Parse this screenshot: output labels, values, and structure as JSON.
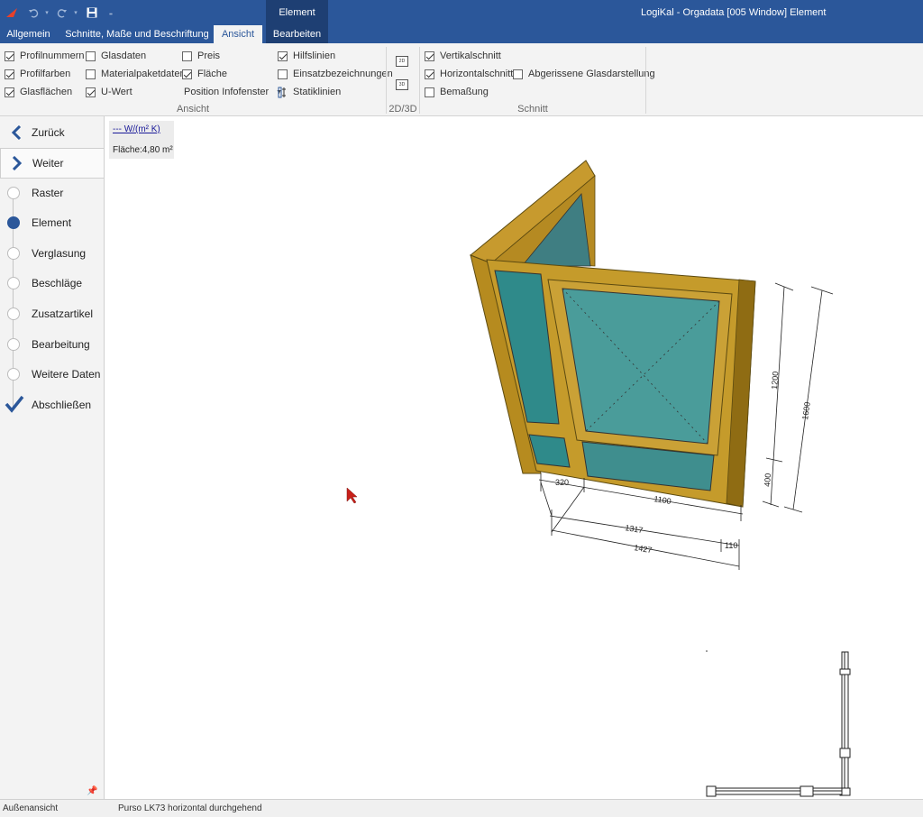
{
  "titlebar": {
    "app_title": "LogiKal - Orgadata [005 Window] Element",
    "context_group": "Element"
  },
  "tabs": [
    "Allgemein",
    "Schnitte, Maße und Beschriftung",
    "Ansicht",
    "Bearbeiten"
  ],
  "ribbon": {
    "ansicht": {
      "label": "Ansicht",
      "checks": [
        {
          "label": "Profilnummern",
          "checked": true
        },
        {
          "label": "Profilfarben",
          "checked": true
        },
        {
          "label": "Glasflächen",
          "checked": true
        },
        {
          "label": "Glasdaten",
          "checked": false
        },
        {
          "label": "Materialpaketdaten",
          "checked": false
        },
        {
          "label": "U-Wert",
          "checked": true
        },
        {
          "label": "Preis",
          "checked": false
        },
        {
          "label": "Fläche",
          "checked": true
        },
        {
          "label": "Hilfslinien",
          "checked": true
        },
        {
          "label": "Einsatzbezeichnungen",
          "checked": false
        }
      ],
      "position_infofenster": "Position Infofenster",
      "statiklinien": "Statiklinien"
    },
    "view_mode": {
      "label": "2D/3D",
      "btn_2d": "2D",
      "btn_3d": "3D"
    },
    "schnitt": {
      "label": "Schnitt",
      "checks": [
        {
          "label": "Vertikalschnitt",
          "checked": true
        },
        {
          "label": "Horizontalschnitt",
          "checked": true
        },
        {
          "label": "Bemaßung",
          "checked": false
        },
        {
          "label": "Abgerissene Glasdarstellung",
          "checked": false
        }
      ]
    }
  },
  "sidebar": {
    "back": "Zurück",
    "next": "Weiter",
    "steps": [
      {
        "label": "Raster",
        "state": "open"
      },
      {
        "label": "Element",
        "state": "current"
      },
      {
        "label": "Verglasung",
        "state": "open"
      },
      {
        "label": "Beschläge",
        "state": "open"
      },
      {
        "label": "Zusatzartikel",
        "state": "open"
      },
      {
        "label": "Bearbeitung",
        "state": "open"
      },
      {
        "label": "Weitere Daten",
        "state": "open"
      },
      {
        "label": "Abschließen",
        "state": "done"
      }
    ]
  },
  "canvas": {
    "info_uvalue": "--- W/(m² K)",
    "info_area": "Fläche:4,80 m²",
    "dimensions": {
      "height_upper": "1200",
      "height_lower": "400",
      "height_total": "1600",
      "width_side": "320",
      "width_front": "1100",
      "width_inner": "1317",
      "width_small": "110",
      "width_total": "1427"
    }
  },
  "statusbar": {
    "view": "Außenansicht",
    "system": "Purso LK73  horizontal durchgehend"
  },
  "colors": {
    "accent": "#2b579a",
    "frame": "#b08a1e",
    "glass": "#2f8a8a"
  }
}
